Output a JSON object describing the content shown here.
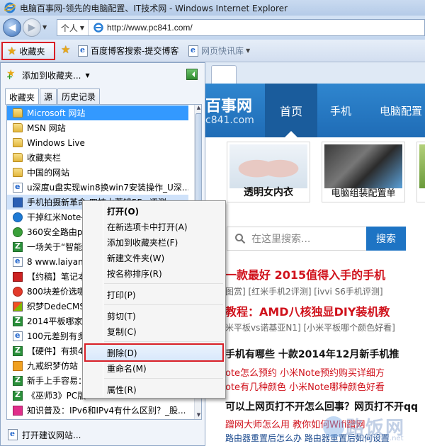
{
  "window": {
    "title": "电脑百事网-领先的电脑配置、IT技术网 - Windows Internet Explorer"
  },
  "address": {
    "profile": "个人",
    "url": "http://www.pc841.com/"
  },
  "favbar": {
    "favorites_label": "收藏夹",
    "links": [
      "百度博客搜索-提交博客",
      "网页快讯库"
    ]
  },
  "panel": {
    "add_to_favorites": "添加到收藏夹...",
    "tabs": [
      "收藏夹",
      "源",
      "历史记录"
    ],
    "items": [
      {
        "label": "Microsoft 网站",
        "icon": "folder"
      },
      {
        "label": "MSN 网站",
        "icon": "folder"
      },
      {
        "label": "Windows Live",
        "icon": "folder"
      },
      {
        "label": "收藏夹栏",
        "icon": "folder"
      },
      {
        "label": "中国的网站",
        "icon": "folder"
      },
      {
        "label": "u深度u盘实现win8换win7安装操作_U深...",
        "icon": "e"
      },
      {
        "label": "手机拍摄新革命 四核水蓄镜5Fe 评测",
        "icon": "b"
      },
      {
        "label": "干掉红米Note-",
        "icon": "q"
      },
      {
        "label": "360安全路由p1",
        "icon": "g"
      },
      {
        "label": "一场关于“智能",
        "icon": "z"
      },
      {
        "label": "8 www.laiyang",
        "icon": "e"
      },
      {
        "label": "【约稿】笔记本",
        "icon": "d"
      },
      {
        "label": "800块差价选哪",
        "icon": "r"
      },
      {
        "label": "织梦DedeCMS",
        "icon": "n"
      },
      {
        "label": "2014平板哪家强",
        "icon": "z"
      },
      {
        "label": "100元差别有多",
        "icon": "e"
      },
      {
        "label": "【硬件】有损4",
        "icon": "z"
      },
      {
        "label": "九戒织梦仿站",
        "icon": "o"
      },
      {
        "label": "新手上手容易：",
        "icon": "z"
      },
      {
        "label": "《巫师3》PC版",
        "icon": "z"
      },
      {
        "label": "知识普及：IPv6和IPv4有什么区别？_股...",
        "icon": "p"
      }
    ],
    "open_suggested": "打开建议网站..."
  },
  "context_menu": {
    "items": [
      "打开(O)",
      "在新选项卡中打开(A)",
      "添加到收藏夹栏(F)",
      "新建文件夹(W)",
      "按名称排序(R)",
      "打印(P)",
      "剪切(T)",
      "复制(C)",
      "删除(D)",
      "重命名(M)",
      "属性(R)"
    ],
    "highlighted": "删除(D)"
  },
  "website": {
    "logo": "百事网",
    "domain": "c841.com",
    "nav": [
      "首页",
      "手机",
      "电脑配置"
    ],
    "tiles": [
      "透明女内衣",
      "电脑组装配置单"
    ],
    "search_placeholder": "在这里搜索...",
    "search_button": "搜索",
    "articles": [
      {
        "text": "一款最好 2015值得入手的手机",
        "style": "a-red"
      },
      {
        "text": "图赏] [红米手机2评测] [ivvi S6手机评测]",
        "style": "a-sub"
      },
      {
        "text": "教程：AMD八核独显DIY装机教",
        "style": "a-red"
      },
      {
        "text": "米平板vs诺基亚N1] [小米平板哪个颜色好看]",
        "style": "a-sub"
      },
      {
        "text": "手机有哪些 十款2014年12月新手机推",
        "style": "a-black"
      },
      {
        "text": "ote怎么预约 小米Note预约购买详细方",
        "style": "a-red2"
      },
      {
        "text": "ote有几种颜色 小米Note哪种颜色好看",
        "style": "a-red2"
      },
      {
        "text": "可以上网页打不开怎么回事？网页打不开qq",
        "style": "a-black"
      },
      {
        "text": "蹭网大师怎么用 教你如何Wifi蹭网",
        "style": "a-red2"
      },
      {
        "text": "路由器重置后怎么办 路由器重置后如何设置",
        "style": "a-blue"
      }
    ]
  },
  "watermark": {
    "text": "路饭网",
    "sub": "www.lufan.net"
  }
}
